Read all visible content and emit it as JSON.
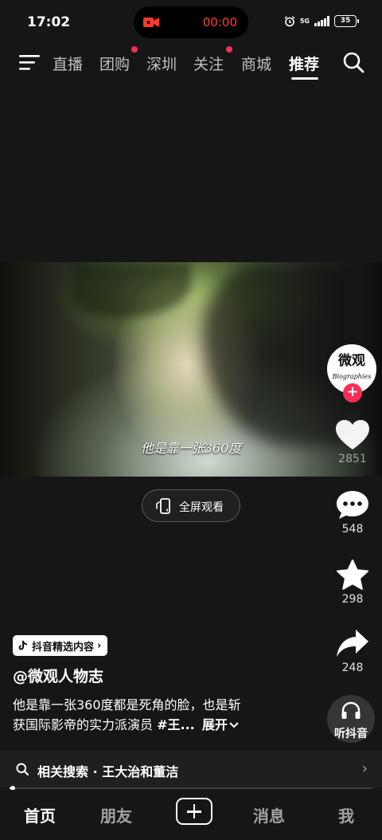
{
  "status_bar": {
    "time": "17:02",
    "recording_time": "00:00",
    "network": "5G",
    "battery": "35"
  },
  "top_nav": {
    "tabs": [
      {
        "label": "直播",
        "active": false,
        "dot": false
      },
      {
        "label": "团购",
        "active": false,
        "dot": true
      },
      {
        "label": "深圳",
        "active": false,
        "dot": false
      },
      {
        "label": "关注",
        "active": false,
        "dot": true
      },
      {
        "label": "商城",
        "active": false,
        "dot": false
      },
      {
        "label": "推荐",
        "active": true,
        "dot": false
      }
    ]
  },
  "video": {
    "subtitle": "他是靠一张360度",
    "fullscreen_label": "全屏观看"
  },
  "author": {
    "avatar_line1": "微观",
    "avatar_line2": "Biographies",
    "handle": "@微观人物志"
  },
  "actions": {
    "likes": "2851",
    "comments": "548",
    "favorites": "298",
    "shares": "248",
    "listen_label": "听抖音"
  },
  "badge": {
    "label": "抖音精选内容",
    "arrow": "›"
  },
  "description": {
    "line1": "他是靠一张360度都是死角的脸，也是斩",
    "line2": "获国际影帝的实力派演员",
    "hashtag": "#王...",
    "expand": "展开"
  },
  "related_search": {
    "text": "相关搜索 · 王大治和董洁",
    "chevron": "›"
  },
  "playback": {
    "progress": 0.008
  },
  "bottom_nav": {
    "items": [
      {
        "label": "首页",
        "active": true
      },
      {
        "label": "朋友",
        "active": false
      },
      {
        "label": "消息",
        "active": false
      },
      {
        "label": "我",
        "active": false
      }
    ]
  },
  "colors": {
    "accent": "#fe2c55",
    "recording": "#ff3b30",
    "background": "#161616"
  }
}
